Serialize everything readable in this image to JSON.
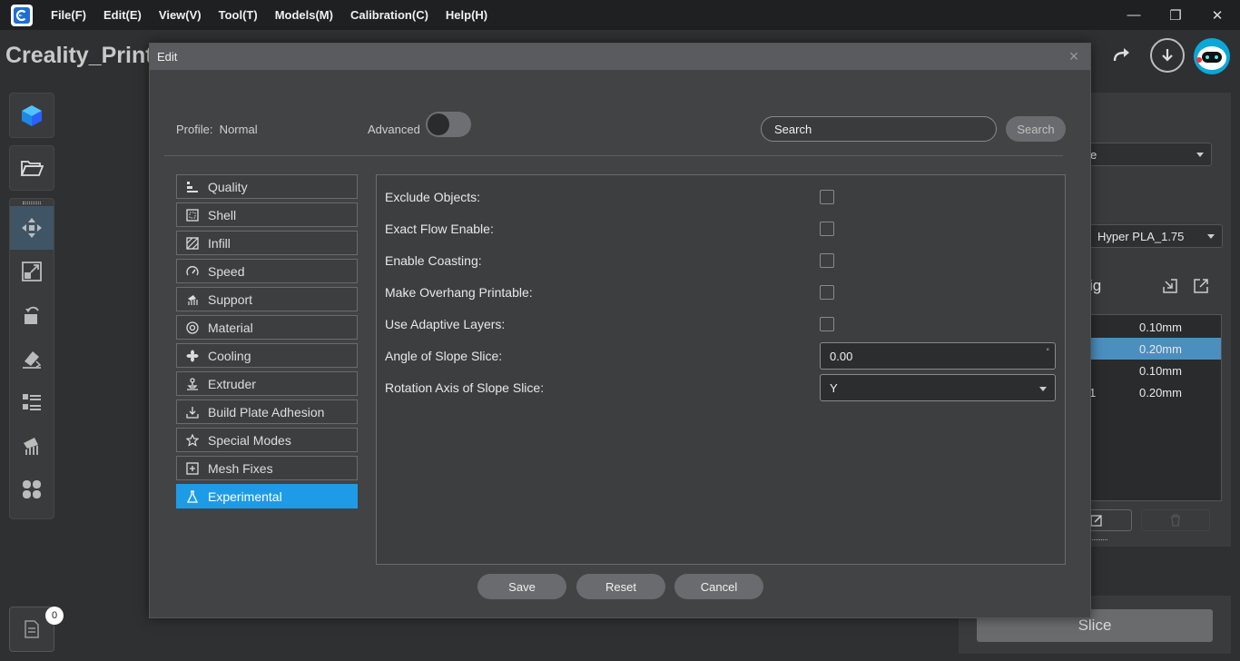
{
  "menubar": {
    "items": [
      "File(F)",
      "Edit(E)",
      "View(V)",
      "Tool(T)",
      "Models(M)",
      "Calibration(C)",
      "Help(H)"
    ],
    "window_controls": {
      "minimize": "—",
      "restore": "❐",
      "close": "✕"
    }
  },
  "project": {
    "title": "Creality_Print"
  },
  "right_panel": {
    "printer_select_tail": "e",
    "material_select": "Hyper PLA_1.75",
    "config_label_tail": "ig",
    "rows": [
      {
        "lead": "",
        "value": "0.10mm",
        "selected": false
      },
      {
        "lead": "",
        "value": "0.20mm",
        "selected": true
      },
      {
        "lead": "",
        "value": "0.10mm",
        "selected": false
      },
      {
        "lead": "1",
        "value": "0.20mm",
        "selected": false
      }
    ]
  },
  "slice_button": "Slice",
  "log_badge": "0",
  "dialog": {
    "title": "Edit",
    "close": "×",
    "profile_label": "Profile:  Normal",
    "advanced_label": "Advanced",
    "advanced_on": false,
    "search_placeholder": "Search",
    "search_button": "Search",
    "categories": [
      {
        "label": "Quality",
        "icon": "quality-icon",
        "active": false
      },
      {
        "label": "Shell",
        "icon": "shell-icon",
        "active": false
      },
      {
        "label": "Infill",
        "icon": "infill-icon",
        "active": false
      },
      {
        "label": "Speed",
        "icon": "speed-icon",
        "active": false
      },
      {
        "label": "Support",
        "icon": "support-icon",
        "active": false
      },
      {
        "label": "Material",
        "icon": "material-icon",
        "active": false
      },
      {
        "label": "Cooling",
        "icon": "fan-icon",
        "active": false
      },
      {
        "label": "Extruder",
        "icon": "extruder-icon",
        "active": false
      },
      {
        "label": "Build Plate Adhesion",
        "icon": "adhesion-icon",
        "active": false
      },
      {
        "label": "Special Modes",
        "icon": "star-icon",
        "active": false
      },
      {
        "label": "Mesh Fixes",
        "icon": "mesh-fix-icon",
        "active": false
      },
      {
        "label": "Experimental",
        "icon": "flask-icon",
        "active": true
      }
    ],
    "settings": {
      "exclude_objects": {
        "label": "Exclude Objects:",
        "checked": false
      },
      "exact_flow": {
        "label": "Exact Flow Enable:",
        "checked": false
      },
      "coasting": {
        "label": "Enable Coasting:",
        "checked": false
      },
      "overhang": {
        "label": "Make Overhang Printable:",
        "checked": false
      },
      "adaptive_layers": {
        "label": "Use Adaptive Layers:",
        "checked": false
      },
      "slope_angle": {
        "label": "Angle of Slope Slice:",
        "value": "0.00",
        "unit": "°"
      },
      "slope_axis": {
        "label": "Rotation Axis of Slope Slice:",
        "value": "Y"
      }
    },
    "buttons": {
      "save": "Save",
      "reset": "Reset",
      "cancel": "Cancel"
    }
  }
}
